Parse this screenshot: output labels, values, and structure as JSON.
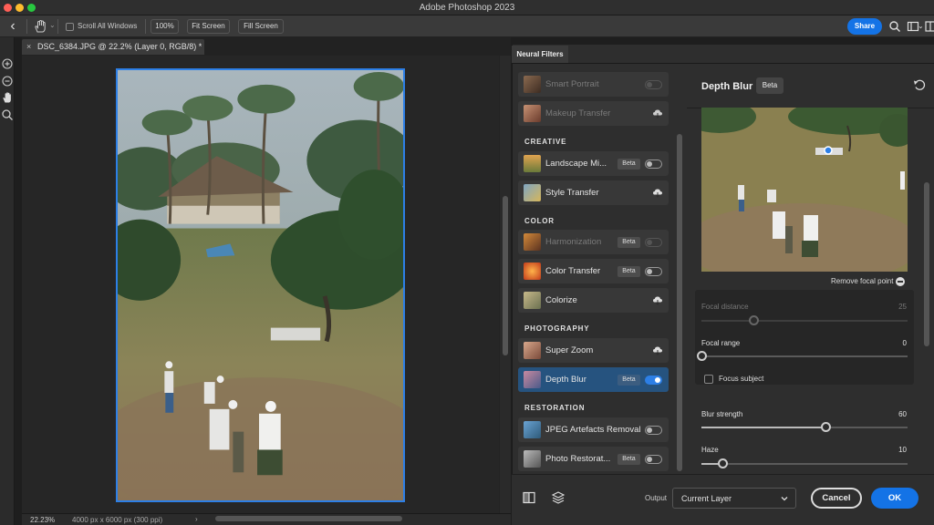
{
  "window": {
    "title": "Adobe Photoshop 2023"
  },
  "options_bar": {
    "scroll_all_windows_label": "Scroll All Windows",
    "zoom_label": "100%",
    "fit_screen_label": "Fit Screen",
    "fill_screen_label": "Fill Screen",
    "share_label": "Share"
  },
  "toolbar": {
    "icons": [
      "zoom-in-icon",
      "zoom-out-icon",
      "hand-icon",
      "search-icon"
    ]
  },
  "document": {
    "tab_title": "DSC_6384.JPG @ 22.2% (Layer 0, RGB/8) *",
    "close_glyph": "×"
  },
  "status_bar": {
    "zoom": "22.23%",
    "dimensions": "4000 px x 6000 px (300 ppi)",
    "arrow": "›"
  },
  "neural_filters": {
    "tab_label": "Neural Filters",
    "sections": [
      {
        "heading": "CREATIVE"
      },
      {
        "heading": "COLOR"
      },
      {
        "heading": "PHOTOGRAPHY"
      },
      {
        "heading": "RESTORATION"
      }
    ],
    "filters": [
      {
        "name": "Smart Portrait",
        "beta": false,
        "state": "off",
        "enabled": false
      },
      {
        "name": "Makeup Transfer",
        "beta": false,
        "state": "download",
        "enabled": false
      },
      {
        "name": "Landscape Mi...",
        "beta": true,
        "beta_label": "Beta",
        "state": "off",
        "enabled": true
      },
      {
        "name": "Style Transfer",
        "beta": false,
        "state": "download",
        "enabled": true
      },
      {
        "name": "Harmonization",
        "beta": true,
        "beta_label": "Beta",
        "state": "off",
        "enabled": false
      },
      {
        "name": "Color Transfer",
        "beta": true,
        "beta_label": "Beta",
        "state": "off",
        "enabled": true
      },
      {
        "name": "Colorize",
        "beta": false,
        "state": "download",
        "enabled": true
      },
      {
        "name": "Super Zoom",
        "beta": false,
        "state": "download",
        "enabled": true
      },
      {
        "name": "Depth Blur",
        "beta": true,
        "beta_label": "Beta",
        "state": "on",
        "enabled": true,
        "selected": true
      },
      {
        "name": "JPEG Artefacts Removal",
        "beta": false,
        "state": "off",
        "enabled": true
      },
      {
        "name": "Photo Restorat...",
        "beta": true,
        "beta_label": "Beta",
        "state": "off",
        "enabled": true
      }
    ]
  },
  "depth_blur": {
    "title": "Depth Blur",
    "beta_label": "Beta",
    "remove_focal_point": "Remove focal point",
    "focal_distance": {
      "label": "Focal distance",
      "value": "25",
      "fraction": 0.25,
      "enabled": false
    },
    "focal_range": {
      "label": "Focal range",
      "value": "0",
      "fraction": 0.0,
      "enabled": true
    },
    "focus_subject": {
      "label": "Focus subject",
      "checked": false
    },
    "blur_strength": {
      "label": "Blur strength",
      "value": "60",
      "fraction": 0.6,
      "enabled": true
    },
    "haze": {
      "label": "Haze",
      "value": "10",
      "fraction": 0.1,
      "enabled": true
    }
  },
  "bottom_bar": {
    "output_label": "Output",
    "output_value": "Current Layer",
    "cancel_label": "Cancel",
    "ok_label": "OK"
  },
  "colors": {
    "accent": "#1473e6",
    "selection_border": "#2d7fe6",
    "panel_bg": "#2e2e2e",
    "selected_item": "#26537f"
  }
}
